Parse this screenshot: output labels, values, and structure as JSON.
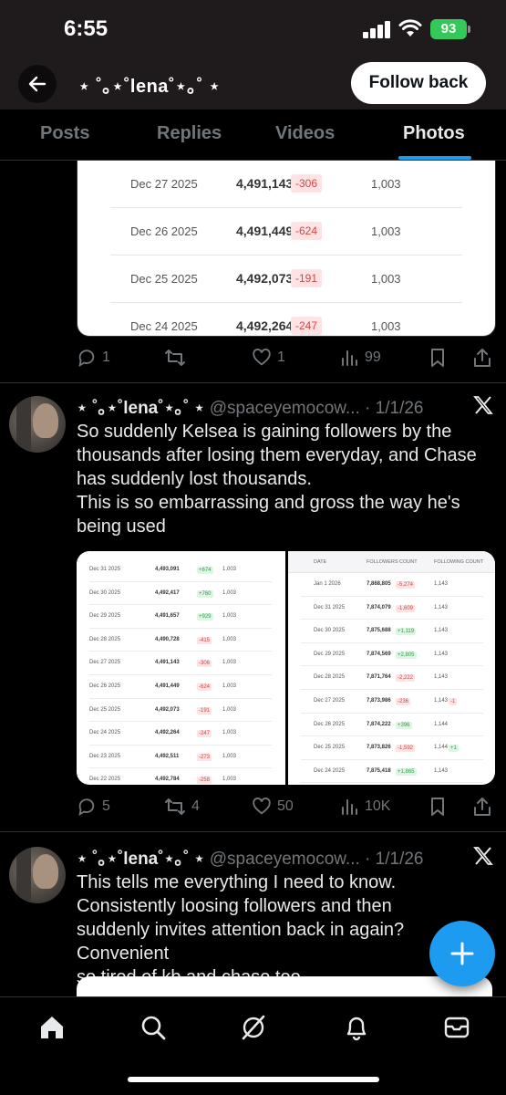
{
  "status_bar": {
    "time": "6:55",
    "battery": "93"
  },
  "header": {
    "name": "⋆ ˚｡⋆˚lena˚⋆｡˚ ⋆",
    "follow_label": "Follow back"
  },
  "tabs": [
    {
      "label": "Posts"
    },
    {
      "label": "Replies"
    },
    {
      "label": "Videos"
    },
    {
      "label": "Photos",
      "active": true
    }
  ],
  "tweet0": {
    "rows": [
      {
        "date": "Dec 27 2025",
        "followers": "4,491,143",
        "change": "-306",
        "following": "1,003"
      },
      {
        "date": "Dec 26 2025",
        "followers": "4,491,449",
        "change": "-624",
        "following": "1,003"
      },
      {
        "date": "Dec 25 2025",
        "followers": "4,492,073",
        "change": "-191",
        "following": "1,003"
      },
      {
        "date": "Dec 24 2025",
        "followers": "4,492,264",
        "change": "-247",
        "following": "1,003"
      }
    ],
    "replies": "1",
    "retweets": "",
    "likes": "1",
    "views": "99"
  },
  "tweet1": {
    "name": "⋆ ˚｡⋆˚lena˚⋆｡˚ ⋆",
    "handle_date": "@spaceyemocow... · 1/1/26",
    "text": "So suddenly Kelsea is gaining followers by the thousands after losing them everyday, and Chase has suddenly lost thousands.\nThis is so embarrassing and gross the way he's being used",
    "left_rows": [
      {
        "date": "Dec 31 2025",
        "followers": "4,493,091",
        "change": "+674",
        "sign": "pos",
        "following": "1,003"
      },
      {
        "date": "Dec 30 2025",
        "followers": "4,492,417",
        "change": "+760",
        "sign": "pos",
        "following": "1,003"
      },
      {
        "date": "Dec 29 2025",
        "followers": "4,491,657",
        "change": "+929",
        "sign": "pos",
        "following": "1,003"
      },
      {
        "date": "Dec 28 2025",
        "followers": "4,490,728",
        "change": "-415",
        "sign": "neg",
        "following": "1,003"
      },
      {
        "date": "Dec 27 2025",
        "followers": "4,491,143",
        "change": "-306",
        "sign": "neg",
        "following": "1,003"
      },
      {
        "date": "Dec 26 2025",
        "followers": "4,491,449",
        "change": "-624",
        "sign": "neg",
        "following": "1,003"
      },
      {
        "date": "Dec 25 2025",
        "followers": "4,492,073",
        "change": "-191",
        "sign": "neg",
        "following": "1,003"
      },
      {
        "date": "Dec 24 2025",
        "followers": "4,492,264",
        "change": "-247",
        "sign": "neg",
        "following": "1,003"
      },
      {
        "date": "Dec 23 2025",
        "followers": "4,492,511",
        "change": "-273",
        "sign": "neg",
        "following": "1,003"
      },
      {
        "date": "Dec 22 2025",
        "followers": "4,492,784",
        "change": "-258",
        "sign": "neg",
        "following": "1,003"
      }
    ],
    "right_headers": {
      "date": "DATE",
      "followers": "FOLLOWERS COUNT",
      "following": "FOLLOWING COUNT"
    },
    "right_rows": [
      {
        "date": "Jan 1 2026",
        "followers": "7,868,805",
        "change": "-5,274",
        "sign": "neg",
        "following": "1,143",
        "fchange": ""
      },
      {
        "date": "Dec 31 2025",
        "followers": "7,874,079",
        "change": "-1,609",
        "sign": "neg",
        "following": "1,143",
        "fchange": ""
      },
      {
        "date": "Dec 30 2025",
        "followers": "7,875,688",
        "change": "+1,119",
        "sign": "pos",
        "following": "1,143",
        "fchange": ""
      },
      {
        "date": "Dec 29 2025",
        "followers": "7,874,569",
        "change": "+2,805",
        "sign": "pos",
        "following": "1,143",
        "fchange": ""
      },
      {
        "date": "Dec 28 2025",
        "followers": "7,871,764",
        "change": "-2,222",
        "sign": "neg",
        "following": "1,143",
        "fchange": ""
      },
      {
        "date": "Dec 27 2025",
        "followers": "7,873,986",
        "change": "-236",
        "sign": "neg",
        "following": "1,143",
        "fchange": "-1"
      },
      {
        "date": "Dec 26 2025",
        "followers": "7,874,222",
        "change": "+396",
        "sign": "pos",
        "following": "1,144",
        "fchange": ""
      },
      {
        "date": "Dec 25 2025",
        "followers": "7,873,826",
        "change": "-1,592",
        "sign": "neg",
        "following": "1,144",
        "fchange": "+1"
      },
      {
        "date": "Dec 24 2025",
        "followers": "7,875,418",
        "change": "+1,865",
        "sign": "pos",
        "following": "1,143",
        "fchange": ""
      }
    ],
    "replies": "5",
    "retweets": "4",
    "likes": "50",
    "views": "10K"
  },
  "tweet2": {
    "name": "⋆ ˚｡⋆˚lena˚⋆｡˚ ⋆",
    "handle_date": "@spaceyemocow... · 1/1/26",
    "text": "This tells me everything I need to know.\nConsistently loosing followers and then suddenly invites attention back in again? Convenient\nso tired of kb and chase too"
  },
  "colors": {
    "accent": "#1d9bf0",
    "positive": "#2e9e4a",
    "negative": "#d64545",
    "battery": "#34c759"
  }
}
